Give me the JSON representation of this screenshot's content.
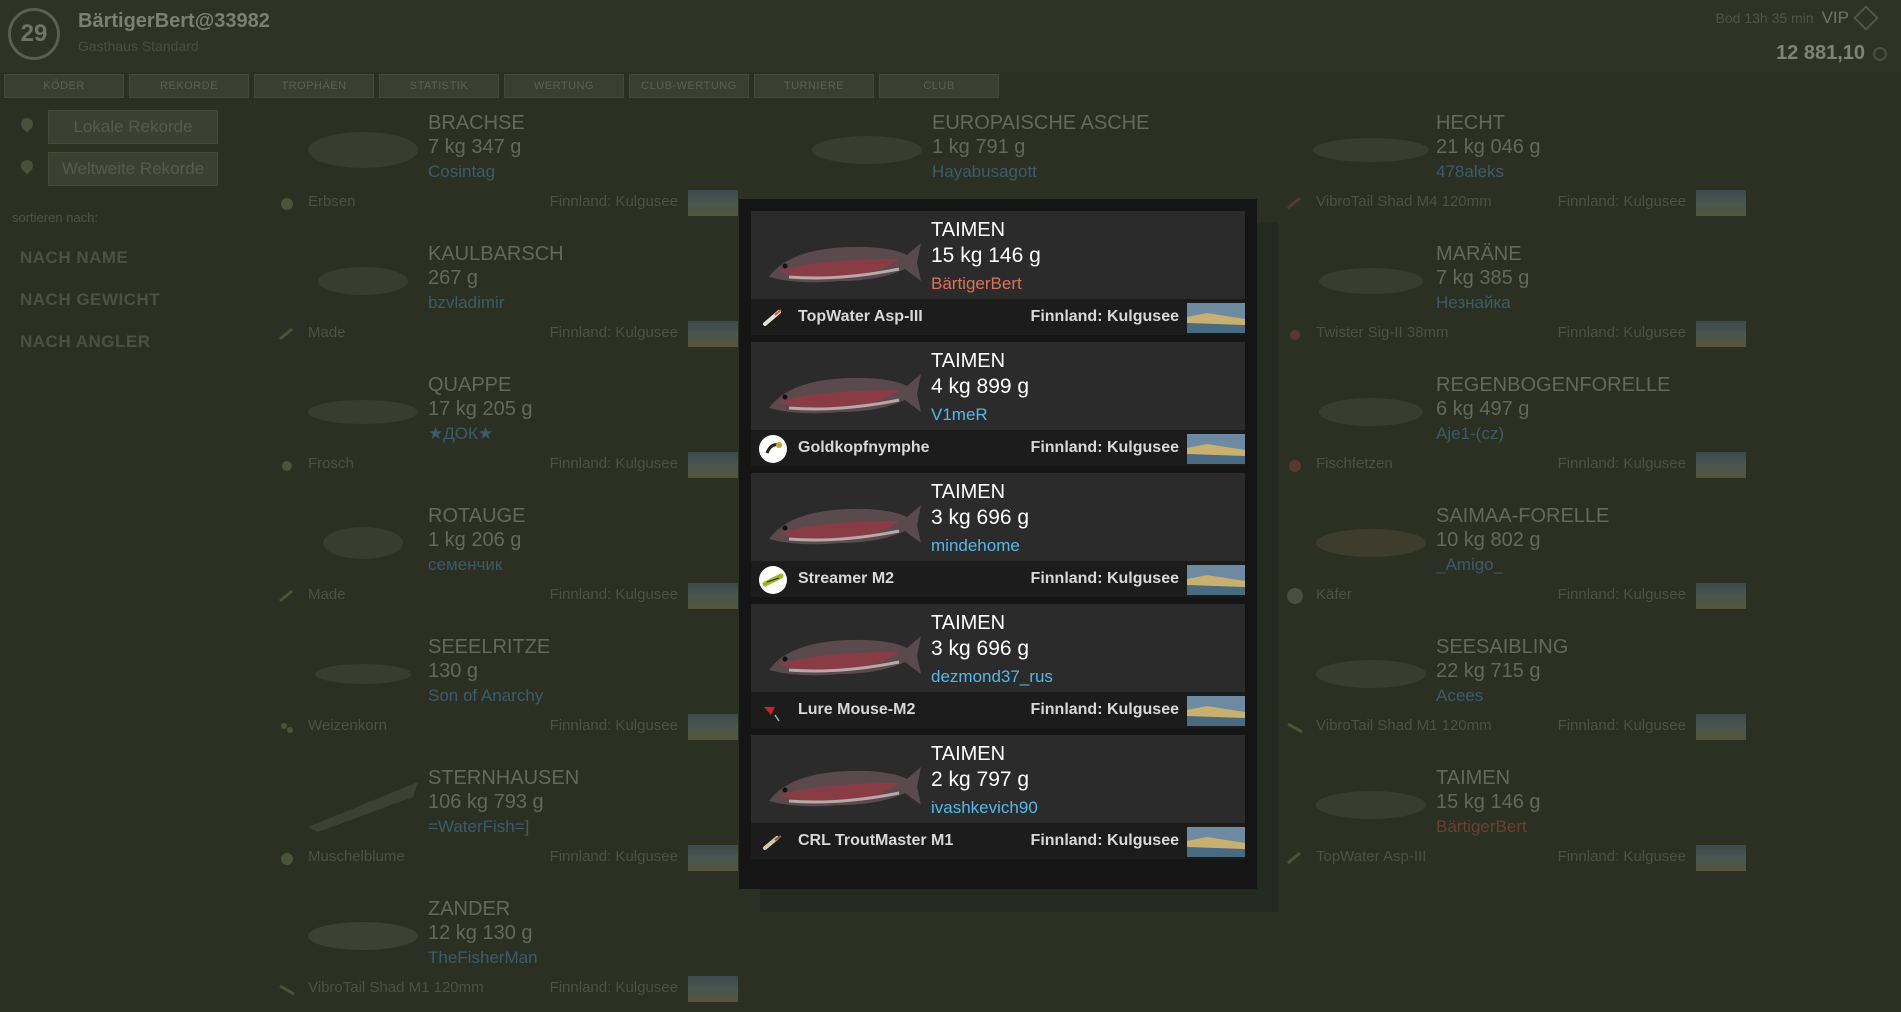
{
  "header": {
    "level": "29",
    "player_name": "BärtigerBert@33982",
    "player_sub": "Gasthaus Standard",
    "timer": "Bod 13h 35 min",
    "vip_label": "VIP",
    "money": "12 881,10"
  },
  "tabs": [
    "KÖDER",
    "REKORDE",
    "TROPHÄEN",
    "STATISTIK",
    "WERTUNG",
    "CLUB-WERTUNG",
    "TURNIERE",
    "CLUB"
  ],
  "sidebar": {
    "local_records": "Lokale Rekorde",
    "world_records": "Weltweite Rekorde",
    "sort_label": "sortieren nach:",
    "sort_by_name": "NACH NAME",
    "sort_by_weight": "NACH GEWICHT",
    "sort_by_angler": "NACH ANGLER"
  },
  "grid": {
    "brachse": {
      "name": "BRACHSE",
      "weight": "7 kg 347 g",
      "angler": "Cosintag",
      "bait": "Erbsen",
      "location": "Finnland: Kulgusee"
    },
    "asche": {
      "name": "EUROPAISCHE ASCHE",
      "weight": "1 kg 791 g",
      "angler": "Hayabusagott"
    },
    "hecht": {
      "name": "HECHT",
      "weight": "21 kg 046 g",
      "angler": "478aleks",
      "bait": "VibroTail Shad M4 120mm",
      "location": "Finnland: Kulgusee"
    },
    "kaulbarsch": {
      "name": "KAULBARSCH",
      "weight": "267 g",
      "angler": "bzvladimir",
      "bait": "Made",
      "location": "Finnland: Kulgusee"
    },
    "marane": {
      "name": "MARÄNE",
      "weight": "7 kg 385 g",
      "angler": "Незнайка",
      "bait": "Twister Sig-II 38mm",
      "location": "Finnland: Kulgusee"
    },
    "quappe": {
      "name": "QUAPPE",
      "weight": "17 kg 205 g",
      "angler": "★ДОК★",
      "bait": "Frosch",
      "location": "Finnland: Kulgusee"
    },
    "regenbogen": {
      "name": "REGENBOGENFORELLE",
      "weight": "6 kg 497 g",
      "angler": "Aje1-(cz)",
      "bait": "Fischfetzen",
      "location": "Finnland: Kulgusee"
    },
    "rotauge": {
      "name": "ROTAUGE",
      "weight": "1 kg 206 g",
      "angler": "семенчик",
      "bait": "Made",
      "location": "Finnland: Kulgusee"
    },
    "saimaa": {
      "name": "SAIMAA-FORELLE",
      "weight": "10 kg 802 g",
      "angler": "_Amigo_",
      "bait": "Käfer",
      "location": "Finnland: Kulgusee"
    },
    "seeelritze": {
      "name": "SEEELRITZE",
      "weight": "130 g",
      "angler": "Son of Anarchy",
      "bait": "Weizenkorn",
      "location": "Finnland: Kulgusee"
    },
    "seesaibling": {
      "name": "SEESAIBLING",
      "weight": "22 kg 715 g",
      "angler": "Acees",
      "bait": "VibroTail Shad M1 120mm",
      "location": "Finnland: Kulgusee"
    },
    "sternhausen": {
      "name": "STERNHAUSEN",
      "weight": "106 kg 793 g",
      "angler": "=WaterFish=]",
      "bait": "Muschelblume",
      "location": "Finnland: Kulgusee"
    },
    "taimen": {
      "name": "TAIMEN",
      "weight": "15 kg 146 g",
      "angler": "BärtigerBert",
      "bait": "TopWater Asp-III",
      "location": "Finnland: Kulgusee"
    },
    "zander": {
      "name": "ZANDER",
      "weight": "12 kg 130 g",
      "angler": "TheFisherMan",
      "bait": "VibroTail Shad M1 120mm",
      "location": "Finnland: Kulgusee"
    }
  },
  "modal": {
    "entries": [
      {
        "name": "TAIMEN",
        "weight": "15 kg 146 g",
        "angler": "BärtigerBert",
        "bait": "TopWater Asp-III",
        "location": "Finnland: Kulgusee"
      },
      {
        "name": "TAIMEN",
        "weight": "4 kg 899 g",
        "angler": "V1meR",
        "bait": "Goldkopfnymphe",
        "location": "Finnland: Kulgusee"
      },
      {
        "name": "TAIMEN",
        "weight": "3 kg 696 g",
        "angler": "mindehome",
        "bait": "Streamer M2",
        "location": "Finnland: Kulgusee"
      },
      {
        "name": "TAIMEN",
        "weight": "3 kg 696 g",
        "angler": "dezmond37_rus",
        "bait": "Lure Mouse-M2",
        "location": "Finnland: Kulgusee"
      },
      {
        "name": "TAIMEN",
        "weight": "2 kg 797 g",
        "angler": "ivashkevich90",
        "bait": "CRL TroutMaster M1",
        "location": "Finnland: Kulgusee"
      }
    ]
  },
  "icons": {
    "fish": "taimen-fish-icon",
    "location": "lake-landscape-icon"
  }
}
